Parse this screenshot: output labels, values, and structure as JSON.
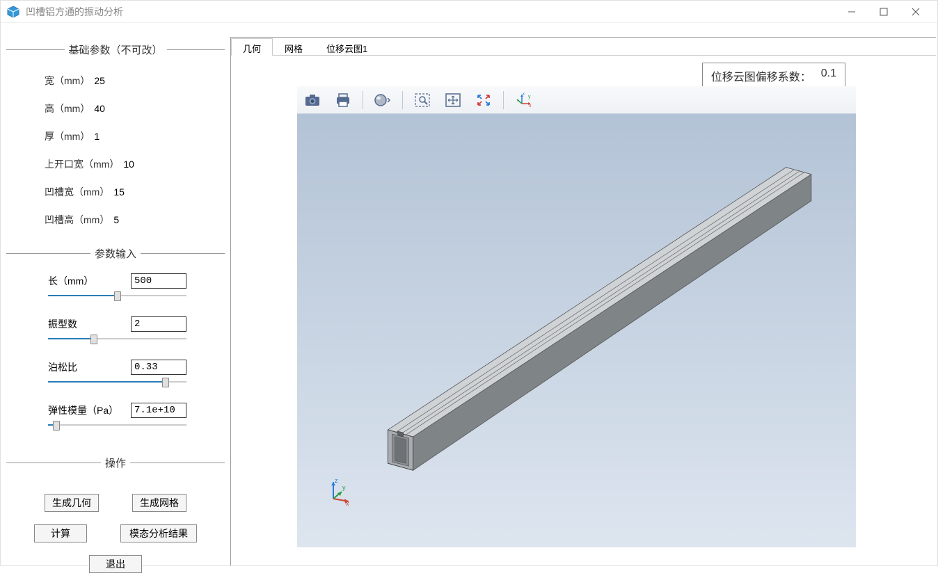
{
  "window": {
    "title": "凹槽铝方通的振动分析"
  },
  "sidebar": {
    "basic_params": {
      "title": "基础参数（不可改）",
      "rows": [
        {
          "label": "宽（mm）",
          "value": "25"
        },
        {
          "label": "高（mm）",
          "value": "40"
        },
        {
          "label": "厚（mm）",
          "value": "1"
        },
        {
          "label": "上开口宽（mm）",
          "value": "10"
        },
        {
          "label": "凹槽宽（mm）",
          "value": "15"
        },
        {
          "label": "凹槽高（mm）",
          "value": "5"
        }
      ]
    },
    "input_params": {
      "title": "参数输入",
      "rows": [
        {
          "label": "长（mm）",
          "value": "500",
          "slider_pct": 50
        },
        {
          "label": "振型数",
          "value": "2",
          "slider_pct": 33
        },
        {
          "label": "泊松比",
          "value": "0.33",
          "slider_pct": 85
        },
        {
          "label": "弹性模量（Pa）",
          "value": "7.1e+10",
          "slider_pct": 6
        }
      ]
    },
    "actions": {
      "title": "操作",
      "buttons": {
        "gen_geometry": "生成几何",
        "gen_mesh": "生成网格",
        "compute": "计算",
        "modal_results": "模态分析结果",
        "exit": "退出"
      }
    }
  },
  "tabs": {
    "items": [
      {
        "label": "几何",
        "active": true
      },
      {
        "label": "网格",
        "active": false
      },
      {
        "label": "位移云图1",
        "active": false
      }
    ]
  },
  "overlay": {
    "label": "位移云图偏移系数：",
    "value": "0.1"
  },
  "toolbar": {
    "icons": [
      "camera-icon",
      "print-icon",
      "sep",
      "render-style-icon",
      "sep",
      "zoom-select-icon",
      "zoom-extents-icon",
      "zoom-full-icon",
      "sep",
      "axis-triad-icon"
    ]
  },
  "axis": {
    "x": "x",
    "y": "y",
    "z": "z"
  }
}
